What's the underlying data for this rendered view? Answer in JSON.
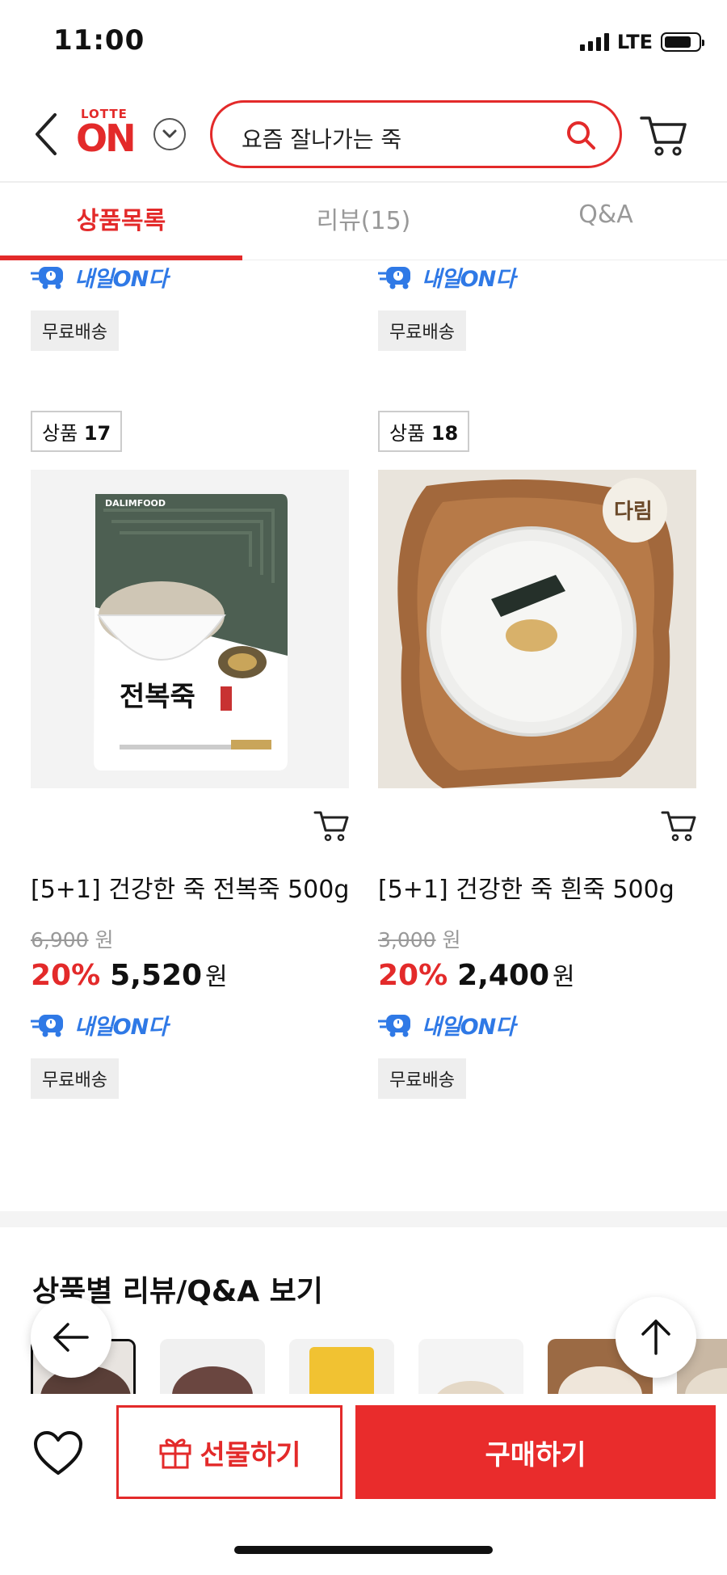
{
  "status_bar": {
    "time": "11:00",
    "network": "LTE"
  },
  "header": {
    "logo_top": "LOTTE",
    "logo_main": "ON",
    "search_text": "요즘 잘나가는 죽"
  },
  "tabs": [
    {
      "label": "상품목록",
      "active": true
    },
    {
      "label": "리뷰(15)",
      "active": false
    },
    {
      "label": "Q&A",
      "active": false
    }
  ],
  "delivery_label": "내일ON다",
  "free_shipping": "무료배송",
  "products": [
    {
      "tag_prefix": "상품",
      "tag_number": "17",
      "name": "[5+1] 건강한 죽 전복죽 500g",
      "original_price": "6,900",
      "discount": "20%",
      "price": "5,520",
      "currency": "원",
      "package_brand": "DALIMFOOD",
      "package_title": "전복죽"
    },
    {
      "tag_prefix": "상품",
      "tag_number": "18",
      "name": "[5+1] 건강한 죽 흰죽 500g",
      "original_price": "3,000",
      "discount": "20%",
      "price": "2,400",
      "currency": "원",
      "package_brand": "",
      "package_title": ""
    }
  ],
  "section": {
    "title": "상품별 리뷰/Q&A 보기"
  },
  "bottom_bar": {
    "gift_label": "선물하기",
    "buy_label": "구매하기"
  },
  "colors": {
    "accent": "#e32a2a",
    "delivery_blue": "#2f79e6"
  },
  "icons": [
    "back-icon",
    "chevron-down-icon",
    "search-icon",
    "cart-icon",
    "truck-icon",
    "add-to-cart-icon",
    "arrow-left-icon",
    "arrow-up-icon",
    "heart-icon",
    "gift-icon"
  ]
}
